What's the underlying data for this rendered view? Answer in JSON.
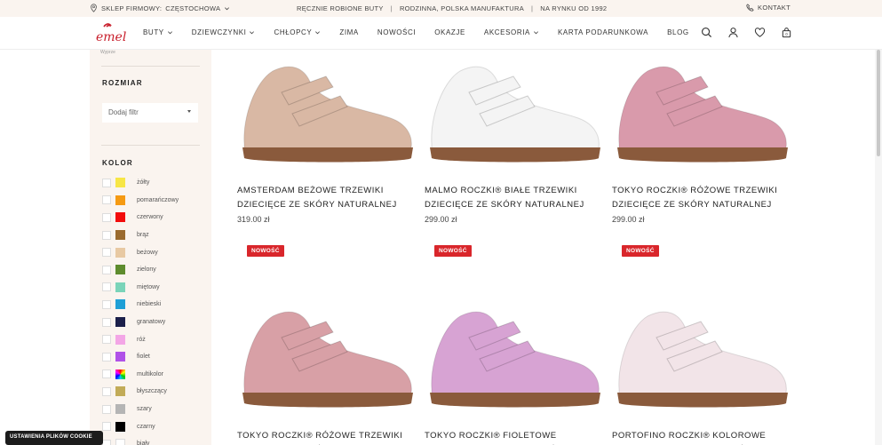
{
  "topbar": {
    "store_label": "SKLEP FIRMOWY:",
    "store_city": "CZĘSTOCHOWA",
    "info": [
      "RĘCZNIE ROBIONE BUTY",
      "RODZINNA, POLSKA MANUFAKTURA",
      "NA RYNKU OD 1992"
    ],
    "separator": "|",
    "contact": "KONTAKT"
  },
  "header": {
    "logo_text": "emel",
    "nav": [
      {
        "label": "BUTY",
        "dropdown": true
      },
      {
        "label": "DZIEWCZYNKI",
        "dropdown": true
      },
      {
        "label": "CHŁOPCY",
        "dropdown": true
      },
      {
        "label": "ZIMA",
        "dropdown": false
      },
      {
        "label": "NOWOŚCI",
        "dropdown": false
      },
      {
        "label": "OKAZJE",
        "dropdown": false
      },
      {
        "label": "AKCESORIA",
        "dropdown": true
      },
      {
        "label": "KARTA PODARUNKOWA",
        "dropdown": false
      },
      {
        "label": "BLOG",
        "dropdown": false
      }
    ],
    "icons": [
      "search-icon",
      "user-icon",
      "heart-icon",
      "bag-icon"
    ]
  },
  "sidebar": {
    "top_text": "Wyprze",
    "size_heading": "ROZMIAR",
    "size_placeholder": "Dodaj filtr",
    "color_heading": "KOLOR",
    "colors": [
      {
        "label": "żółty",
        "hex": "#f7e646"
      },
      {
        "label": "pomarańczowy",
        "hex": "#f59a12"
      },
      {
        "label": "czerwony",
        "hex": "#f20c0c"
      },
      {
        "label": "brąz",
        "hex": "#9a6a2e"
      },
      {
        "label": "beżowy",
        "hex": "#e8c9a3"
      },
      {
        "label": "zielony",
        "hex": "#5e8c2e"
      },
      {
        "label": "miętowy",
        "hex": "#7ad4b9"
      },
      {
        "label": "niebieski",
        "hex": "#1e9fd6"
      },
      {
        "label": "granatowy",
        "hex": "#1b1f4a"
      },
      {
        "label": "róż",
        "hex": "#f3a6e6"
      },
      {
        "label": "fiolet",
        "hex": "#b052e8"
      },
      {
        "label": "multikolor",
        "hex": "multi"
      },
      {
        "label": "błyszczący",
        "hex": "#c2ab58"
      },
      {
        "label": "szary",
        "hex": "#b5b5b5"
      },
      {
        "label": "czarny",
        "hex": "#000000"
      },
      {
        "label": "biały",
        "hex": "#ffffff"
      }
    ]
  },
  "cookie_button": "USTAWIENIA PLIKÓW COOKIE",
  "products": [
    {
      "title_lines": [
        "AMSTERDAM BEŻOWE TRZEWIKI",
        "DZIECIĘCE ZE SKÓRY NATURALNEJ"
      ],
      "price": "319.00 zł",
      "badge": "",
      "color": "#d9b8a4"
    },
    {
      "title_lines": [
        "MALMO ROCZKI® BIAŁE TRZEWIKI",
        "DZIECIĘCE ZE SKÓRY NATURALNEJ"
      ],
      "price": "299.00 zł",
      "badge": "",
      "color": "#f4f4f4"
    },
    {
      "title_lines": [
        "TOKYO ROCZKI® RÓŻOWE TRZEWIKI",
        "DZIECIĘCE ZE SKÓRY NATURALNEJ"
      ],
      "price": "299.00 zł",
      "badge": "",
      "color": "#d99aab"
    },
    {
      "title_lines": [
        "TOKYO ROCZKI® RÓŻOWE TRZEWIKI",
        "DZIECIĘCE ZE SKÓRY NATURALNEJ"
      ],
      "price": "",
      "badge": "NOWOŚĆ",
      "color": "#d8a0a6"
    },
    {
      "title_lines": [
        "TOKYO ROCZKI® FIOLETOWE",
        "TRZEWIKI DZIECIĘCE ZE SKÓRY"
      ],
      "price": "",
      "badge": "NOWOŚĆ",
      "color": "#d7a3d3"
    },
    {
      "title_lines": [
        "PORTOFINO ROCZKI® KOLOROWE",
        "BALERINY DZIECIĘCE ZE SKÓRY"
      ],
      "price": "",
      "badge": "NOWOŚĆ",
      "color": "#f2e4e8"
    }
  ]
}
